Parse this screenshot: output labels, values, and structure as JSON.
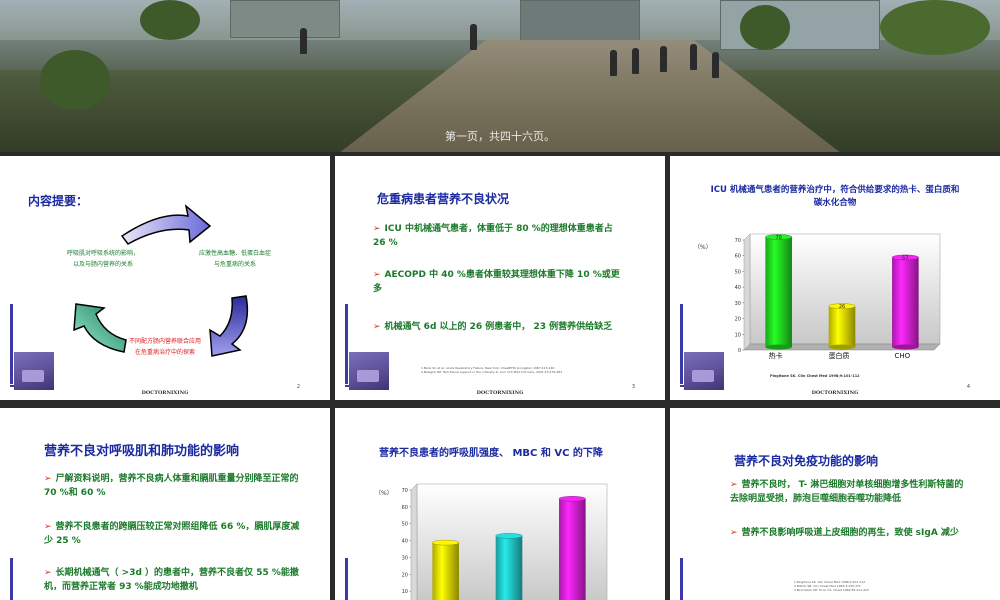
{
  "banner": {
    "caption": "第一页，共四十六页。"
  },
  "footer_brand": "DOCTORNIXING",
  "slides": [
    {
      "title": "内容提要：",
      "items": [
        "呼吸肌对呼吸系统的影响，",
        "以及与肠内营养的关系",
        "应激性高血糖、低蛋白血症",
        "与危重病的关系",
        "不同配方肠内营养联合应用",
        "在危重病治疗中的探索"
      ],
      "page": "2"
    },
    {
      "title": "危重病患者营养不良状况",
      "bullets": [
        "ICU 中机械通气患者，体重低于 80 %的理想体重患者占 26 %",
        "AECOPD 中 40 %患者体重较其理想体重下降 10 %或更多",
        "机械通气 6d 以上的 26 例患者中，  23 例营养供给缺乏"
      ],
      "refs": [
        "1.Benz SC et al. Acute Respiratory Failure. New York: ChestPHD Livingston 1987;115-126",
        "2.Belegrin RE. Nutritional support in the critically ill. Curr Crit Med Crit Care. 2001;15:479-483"
      ],
      "page": "3"
    },
    {
      "title": "ICU 机械通气患者的营养治疗中，符合供给要求的热卡、蛋白质和碳水化合物",
      "unit": "（%）",
      "source": "Pingitone SK. Clin Chest Med  1998;9:101-112",
      "page": "4"
    },
    {
      "title": "营养不良对呼吸肌和肺功能的影响",
      "bullets": [
        "尸解资料说明，营养不良病人体重和膈肌重量分别降至正常的 70 %和 60 %",
        "营养不良患者的跨膈压较正常对照组降低 66 %，膈肌厚度减少 25 %",
        "长期机械通气（ >3d ）的患者中，营养不良者仅 55 %能撤机，而营养正常者 93 %能成功地撤机"
      ]
    },
    {
      "title": "营养不良患者的呼吸肌强度、 MBC 和 VC 的下降",
      "unit": "（%）"
    },
    {
      "title": "营养不良对免疫功能的影响",
      "bullets": [
        "营养不良时， T- 淋巴细胞对单核细胞增多性利斯特菌的去除明显受损，肺泡巨噬细胞吞噬功能降低",
        "营养不良影响呼吸道上皮细胞的再生，致使 sIgA 减少"
      ],
      "refs": [
        "1.Pingitone SK. Clin Chest Med  1988;9:101-112",
        "2.Martin SB. Clin Chest Med 1983;4:335-371",
        "3.Bercheierr KE. Econ CS. Chest 1984;85:411-415"
      ]
    }
  ],
  "chart_data": [
    {
      "type": "bar",
      "categories": [
        "热卡",
        "蛋白质",
        "CHO"
      ],
      "values": [
        70,
        26,
        57
      ],
      "ylim": [
        0,
        70
      ],
      "yticks": [
        0,
        10,
        20,
        30,
        40,
        50,
        60,
        70
      ],
      "colors": [
        "#22dd22",
        "#e8e000",
        "#dd22dd"
      ],
      "title": "ICU 机械通气患者的营养治疗中，符合供给要求的热卡、蛋白质和碳水化合物",
      "ylabel": "（%）"
    },
    {
      "type": "bar",
      "categories": [
        "",
        "",
        ""
      ],
      "values": [
        37,
        41,
        63
      ],
      "ylim": [
        0,
        70
      ],
      "yticks": [
        10,
        20,
        30,
        40,
        50,
        60,
        70
      ],
      "colors": [
        "#e8e000",
        "#22cccc",
        "#dd22dd"
      ],
      "title": "营养不良患者的呼吸肌强度、 MBC 和 VC 的下降",
      "ylabel": "（%）"
    }
  ]
}
